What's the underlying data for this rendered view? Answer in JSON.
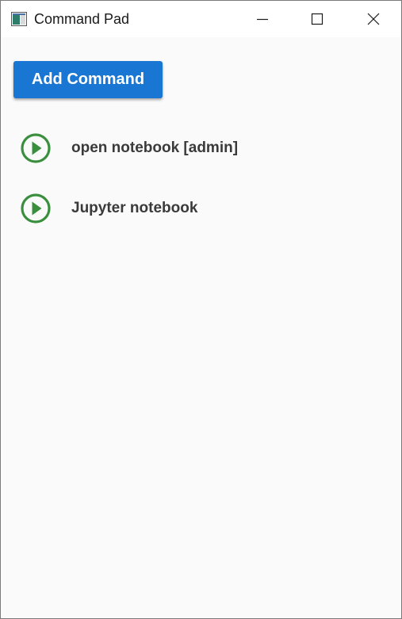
{
  "window": {
    "title": "Command Pad",
    "app_icon": "app-window-icon",
    "controls": {
      "minimize_icon": "minimize-icon",
      "maximize_icon": "maximize-icon",
      "close_icon": "close-icon"
    }
  },
  "toolbar": {
    "add_label": "Add Command",
    "accent_color": "#1976d2"
  },
  "commands": [
    {
      "label": "open notebook [admin]",
      "icon": "play-circle-icon"
    },
    {
      "label": "Jupyter notebook",
      "icon": "play-circle-icon"
    }
  ],
  "colors": {
    "play_icon": "#3a8f3e",
    "background": "#fafafa",
    "text": "#3a3a3a"
  }
}
